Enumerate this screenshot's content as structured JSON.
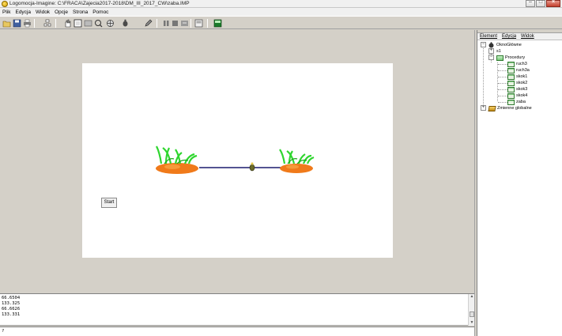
{
  "window": {
    "title": "Logomocja-Imagine: C:\\FRACA\\Zajecia2017-2018\\DM_III_2017_CW\\zaba.IMP",
    "controls": [
      "minimize-icon",
      "maximize-icon",
      "close-icon"
    ]
  },
  "menu": {
    "items": [
      "Plik",
      "Edycja",
      "Widok",
      "Opcje",
      "Strona",
      "Pomoc"
    ]
  },
  "toolbar": {
    "icons": [
      "open-icon",
      "save-icon",
      "print-icon",
      "pages-icon",
      "hand-icon",
      "frame-icon",
      "rectangle-icon",
      "paint-icon",
      "network-icon",
      "turtle-icon",
      "pen-icon",
      "stop-icon",
      "run-icon",
      "slide-icon",
      "control-panel-icon",
      "screen-icon"
    ]
  },
  "page": {
    "start_button": "Start"
  },
  "tree_panel": {
    "menu": [
      "Element",
      "Edycja",
      "Widok"
    ],
    "root": "OknoGłówne",
    "page": "s1",
    "procedures_folder": "Procedury",
    "procedures": [
      "ruch3",
      "ruch3a",
      "skok1",
      "skok2",
      "skok3",
      "skok4",
      "zaba"
    ],
    "globals": "Zmienne globalne"
  },
  "history": {
    "lines": [
      "66.6504",
      "133.325",
      "66.6626",
      "133.331"
    ]
  },
  "command": {
    "prompt": "?",
    "value": ""
  },
  "colors": {
    "carrot": "#f07a1a",
    "grass": "#2fd62f",
    "line": "#1a1a6e"
  }
}
